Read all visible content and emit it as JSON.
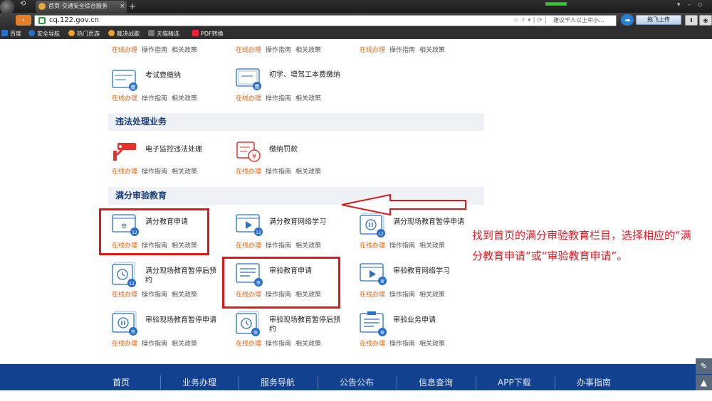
{
  "browser": {
    "tab_title": "首页-交通安全综合服务",
    "tab_close": "×",
    "new_tab": "+",
    "url": "cq.122.gov.cn",
    "search_hint": "建议千人以上中小...",
    "upload_label": "拖飞上传",
    "bookmarks": [
      "百度",
      "安全导航",
      "热门页游",
      "裁决战歌",
      "天猫精选",
      "PDF转换"
    ]
  },
  "links": {
    "online": "在线办理",
    "guide": "操作指南",
    "policy": "相关政策"
  },
  "top_services": [
    {
      "title": "考试费缴纳",
      "badge": "缴"
    },
    {
      "title": "初学、增驾工本费缴纳",
      "badge": "缴"
    }
  ],
  "sections": [
    {
      "title": "违法处理业务",
      "items": [
        {
          "title": "电子监控违法处理"
        },
        {
          "title": "缴纳罚款"
        }
      ]
    },
    {
      "title": "满分审验教育",
      "items": [
        {
          "title": "满分教育申请",
          "badge": "12"
        },
        {
          "title": "满分教育网络学习",
          "badge": "12"
        },
        {
          "title": "满分现场教育暂停申请",
          "badge": "12"
        },
        {
          "title": "满分现场教育暂停后预约",
          "badge": "12"
        },
        {
          "title": "审验教育申请",
          "badge": "审"
        },
        {
          "title": "审验教育网络学习",
          "badge": "审"
        },
        {
          "title": "审验现场教育暂停申请",
          "badge": "审"
        },
        {
          "title": "审验现场教育暂停后预约",
          "badge": "审"
        },
        {
          "title": "审验业务申请",
          "badge": "审"
        }
      ]
    }
  ],
  "annotation": "找到首页的满分审验教育栏目，选择相应的“满分教育申请”或“审验教育申请”。",
  "footer_nav": [
    "首页",
    "业务办理",
    "服务导航",
    "公告公布",
    "信息查询",
    "APP下载",
    "办事指南"
  ],
  "colors": {
    "accent_blue": "#2a6fc9",
    "link_orange": "#e8620c",
    "highlight_red": "#e21818",
    "footer_bg": "#12428f"
  }
}
